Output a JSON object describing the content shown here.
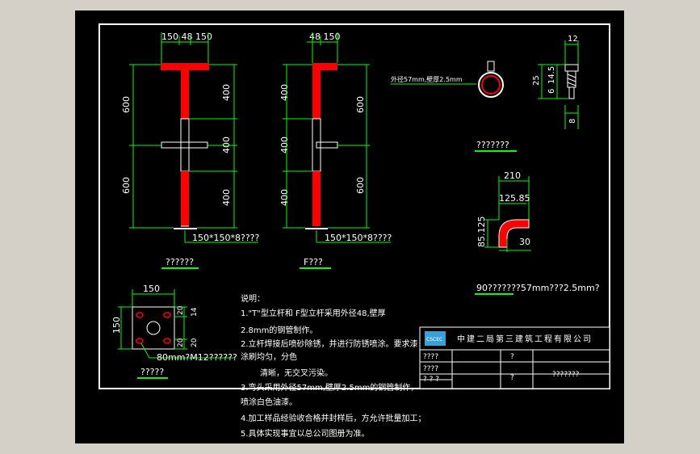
{
  "colors": {
    "background_outer": "#d4d0c8",
    "sheet": "#000000",
    "border": "#ffffff",
    "dimension": "#00ff00",
    "post_red": "#ff0000",
    "post_white": "#ffffff",
    "underline": "#00ff00"
  },
  "post_t": {
    "top_dims": "150 48 150",
    "left_dims": [
      "600",
      "600"
    ],
    "right_dims": [
      "400",
      "400",
      "400"
    ],
    "base_label": "150*150*8????",
    "caption": "??????"
  },
  "post_f": {
    "top_dims": "48 150",
    "left_dims": [
      "400",
      "400",
      "400"
    ],
    "right_dims": [
      "600",
      "600"
    ],
    "base_label": "150*150*8????",
    "caption": "F???"
  },
  "clamp": {
    "note": "外径57mm,壁厚2.5mm",
    "caption": "???????"
  },
  "bolt": {
    "dims": [
      "12",
      "25",
      "6",
      "14.5",
      "8"
    ]
  },
  "elbow": {
    "dims": [
      "210",
      "125.85",
      "85.125",
      "30"
    ],
    "caption": "90???????57mm???2.5mm?"
  },
  "base_plate": {
    "width": "150",
    "height": "150",
    "small_dims": [
      "20",
      "14",
      "20",
      "20"
    ],
    "label": "80mm?M12??????",
    "caption": "?????"
  },
  "notes": {
    "heading": "说明：",
    "lines": [
      "1.\"T\"型立杆和 F型立杆采用外径48,壁厚",
      "2.8mm的钢管制作。",
      "2.立杆焊接后喷砂除锈，并进行防锈喷涂。要求漆",
      "涂刷均匀，分色",
      "清晰，无交叉污染。",
      "3.弯头采用外径57mm,壁厚2.5mm的钢管制作，",
      "喷涂白色油漆。",
      "4.加工样品经验收合格并封样后，方允许批量加工；",
      "5.具体实现事宜以总公司图册为准。"
    ]
  },
  "title_block": {
    "company": "中建二局第三建筑工程有限公司",
    "logo_text": "CSCEC",
    "cells": [
      "????",
      "????",
      "? ? ?",
      "?",
      "?",
      "???????"
    ]
  }
}
